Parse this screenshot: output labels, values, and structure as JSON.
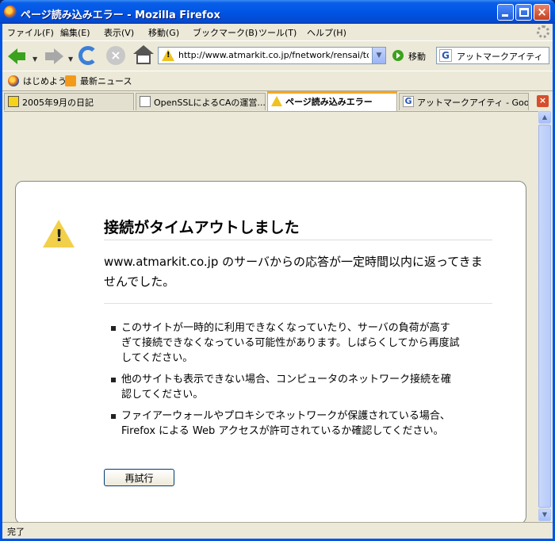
{
  "window": {
    "title": "ページ読み込みエラー - Mozilla Firefox",
    "close_glyph": "×"
  },
  "menu": {
    "items": [
      {
        "label": "ファイル(F)"
      },
      {
        "label": "編集(E)"
      },
      {
        "label": "表示(V)"
      },
      {
        "label": "移動(G)"
      },
      {
        "label": "ブックマーク(B)"
      },
      {
        "label": "ツール(T)"
      },
      {
        "label": "ヘルプ(H)"
      }
    ]
  },
  "toolbar": {
    "url": "http://www.atmarkit.co.jp/fnetwork/rensai/tcp",
    "go_label": "移動",
    "search_engine_glyph": "G",
    "search_text": "アットマークアイティ",
    "stop_glyph": "×"
  },
  "bookmarks": {
    "items": [
      {
        "label": "はじめよう",
        "icon": "firefox-icon"
      },
      {
        "label": "最新ニュース",
        "icon": "rss-icon"
      }
    ]
  },
  "tabs": [
    {
      "label": "2005年9月の日記",
      "icon": "arrow-page-icon",
      "active": false
    },
    {
      "label": "OpenSSLによるCAの運営...",
      "icon": "page-icon",
      "active": false
    },
    {
      "label": "ページ読み込みエラー",
      "icon": "warning-icon",
      "active": true
    },
    {
      "label": "アットマークアイティ - Googl...",
      "icon": "google-icon",
      "active": false
    }
  ],
  "error": {
    "title": "接続がタイムアウトしました",
    "description": "www.atmarkit.co.jp のサーバからの応答が一定時間以内に返ってきませんでした。",
    "items": [
      "このサイトが一時的に利用できなくなっていたり、サーバの負荷が高すぎて接続できなくなっている可能性があります。しばらくしてから再度試してください。",
      "他のサイトも表示できない場合、コンピュータのネットワーク接続を確認してください。",
      "ファイアーウォールやプロキシでネットワークが保護されている場合、Firefox による Web アクセスが許可されているか確認してください。"
    ],
    "retry_label": "再試行",
    "warning_glyph": "!"
  },
  "status": {
    "text": "完了"
  },
  "colors": {
    "titlebar": "#0055e5",
    "chrome": "#ece9d8",
    "warning": "#f3d04a",
    "active_tab_accent": "#f5a623"
  }
}
